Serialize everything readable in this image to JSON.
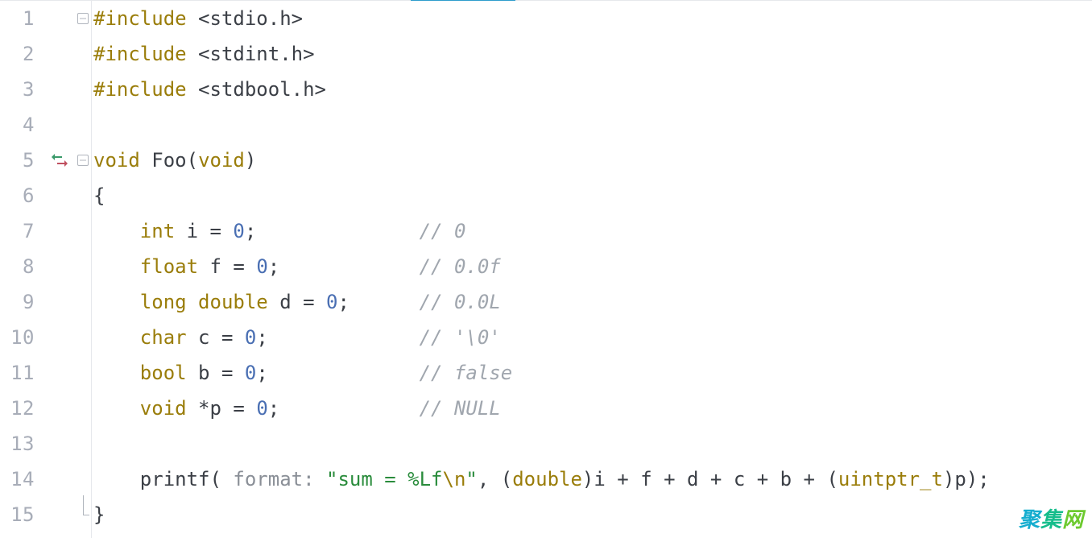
{
  "tab_accent_color": "#2e9ccc",
  "line_numbers": [
    "1",
    "2",
    "3",
    "4",
    "5",
    "6",
    "7",
    "8",
    "9",
    "10",
    "11",
    "12",
    "13",
    "14",
    "15"
  ],
  "code": {
    "lines": [
      {
        "tokens": [
          {
            "cls": "kw",
            "t": "#include"
          },
          {
            "cls": "",
            "t": " "
          },
          {
            "cls": "punct",
            "t": "<"
          },
          {
            "cls": "ident",
            "t": "stdio.h"
          },
          {
            "cls": "punct",
            "t": ">"
          }
        ]
      },
      {
        "tokens": [
          {
            "cls": "kw",
            "t": "#include"
          },
          {
            "cls": "",
            "t": " "
          },
          {
            "cls": "punct",
            "t": "<"
          },
          {
            "cls": "ident",
            "t": "stdint.h"
          },
          {
            "cls": "punct",
            "t": ">"
          }
        ]
      },
      {
        "tokens": [
          {
            "cls": "kw",
            "t": "#include"
          },
          {
            "cls": "",
            "t": " "
          },
          {
            "cls": "punct",
            "t": "<"
          },
          {
            "cls": "ident",
            "t": "stdbool.h"
          },
          {
            "cls": "punct",
            "t": ">"
          }
        ]
      },
      {
        "tokens": [
          {
            "cls": "",
            "t": ""
          }
        ]
      },
      {
        "tokens": [
          {
            "cls": "kw",
            "t": "void"
          },
          {
            "cls": "",
            "t": " "
          },
          {
            "cls": "ident",
            "t": "Foo"
          },
          {
            "cls": "punct",
            "t": "("
          },
          {
            "cls": "kw",
            "t": "void"
          },
          {
            "cls": "punct",
            "t": ")"
          }
        ]
      },
      {
        "tokens": [
          {
            "cls": "punct",
            "t": "{"
          }
        ]
      },
      {
        "tokens": [
          {
            "cls": "",
            "t": "    "
          },
          {
            "cls": "kw",
            "t": "int"
          },
          {
            "cls": "",
            "t": " "
          },
          {
            "cls": "ident",
            "t": "i"
          },
          {
            "cls": "",
            "t": " "
          },
          {
            "cls": "punct",
            "t": "="
          },
          {
            "cls": "",
            "t": " "
          },
          {
            "cls": "num",
            "t": "0"
          },
          {
            "cls": "punct",
            "t": ";"
          },
          {
            "cls": "",
            "t": "              "
          },
          {
            "cls": "cmt",
            "t": "// 0"
          }
        ]
      },
      {
        "tokens": [
          {
            "cls": "",
            "t": "    "
          },
          {
            "cls": "kw",
            "t": "float"
          },
          {
            "cls": "",
            "t": " "
          },
          {
            "cls": "ident",
            "t": "f"
          },
          {
            "cls": "",
            "t": " "
          },
          {
            "cls": "punct",
            "t": "="
          },
          {
            "cls": "",
            "t": " "
          },
          {
            "cls": "num",
            "t": "0"
          },
          {
            "cls": "punct",
            "t": ";"
          },
          {
            "cls": "",
            "t": "            "
          },
          {
            "cls": "cmt",
            "t": "// 0.0f"
          }
        ]
      },
      {
        "tokens": [
          {
            "cls": "",
            "t": "    "
          },
          {
            "cls": "kw",
            "t": "long"
          },
          {
            "cls": "",
            "t": " "
          },
          {
            "cls": "kw",
            "t": "double"
          },
          {
            "cls": "",
            "t": " "
          },
          {
            "cls": "ident",
            "t": "d"
          },
          {
            "cls": "",
            "t": " "
          },
          {
            "cls": "punct",
            "t": "="
          },
          {
            "cls": "",
            "t": " "
          },
          {
            "cls": "num",
            "t": "0"
          },
          {
            "cls": "punct",
            "t": ";"
          },
          {
            "cls": "",
            "t": "      "
          },
          {
            "cls": "cmt",
            "t": "// 0.0L"
          }
        ]
      },
      {
        "tokens": [
          {
            "cls": "",
            "t": "    "
          },
          {
            "cls": "kw",
            "t": "char"
          },
          {
            "cls": "",
            "t": " "
          },
          {
            "cls": "ident",
            "t": "c"
          },
          {
            "cls": "",
            "t": " "
          },
          {
            "cls": "punct",
            "t": "="
          },
          {
            "cls": "",
            "t": " "
          },
          {
            "cls": "num",
            "t": "0"
          },
          {
            "cls": "punct",
            "t": ";"
          },
          {
            "cls": "",
            "t": "             "
          },
          {
            "cls": "cmt",
            "t": "// '\\0'"
          }
        ]
      },
      {
        "tokens": [
          {
            "cls": "",
            "t": "    "
          },
          {
            "cls": "kw",
            "t": "bool"
          },
          {
            "cls": "",
            "t": " "
          },
          {
            "cls": "ident",
            "t": "b"
          },
          {
            "cls": "",
            "t": " "
          },
          {
            "cls": "punct",
            "t": "="
          },
          {
            "cls": "",
            "t": " "
          },
          {
            "cls": "num",
            "t": "0"
          },
          {
            "cls": "punct",
            "t": ";"
          },
          {
            "cls": "",
            "t": "             "
          },
          {
            "cls": "cmt",
            "t": "// false"
          }
        ]
      },
      {
        "tokens": [
          {
            "cls": "",
            "t": "    "
          },
          {
            "cls": "kw",
            "t": "void"
          },
          {
            "cls": "",
            "t": " "
          },
          {
            "cls": "punct",
            "t": "*"
          },
          {
            "cls": "ident",
            "t": "p"
          },
          {
            "cls": "",
            "t": " "
          },
          {
            "cls": "punct",
            "t": "="
          },
          {
            "cls": "",
            "t": " "
          },
          {
            "cls": "num",
            "t": "0"
          },
          {
            "cls": "punct",
            "t": ";"
          },
          {
            "cls": "",
            "t": "            "
          },
          {
            "cls": "cmt",
            "t": "// NULL"
          }
        ]
      },
      {
        "tokens": [
          {
            "cls": "",
            "t": ""
          }
        ]
      },
      {
        "tokens": [
          {
            "cls": "",
            "t": "    "
          },
          {
            "cls": "ident",
            "t": "printf"
          },
          {
            "cls": "punct",
            "t": "( "
          },
          {
            "cls": "hint",
            "t": "format: "
          },
          {
            "cls": "str",
            "t": "\"sum = %Lf"
          },
          {
            "cls": "escape",
            "t": "\\n"
          },
          {
            "cls": "str",
            "t": "\""
          },
          {
            "cls": "punct",
            "t": ", ("
          },
          {
            "cls": "kw",
            "t": "double"
          },
          {
            "cls": "punct",
            "t": ")"
          },
          {
            "cls": "ident",
            "t": "i"
          },
          {
            "cls": "",
            "t": " "
          },
          {
            "cls": "punct",
            "t": "+"
          },
          {
            "cls": "",
            "t": " "
          },
          {
            "cls": "ident",
            "t": "f"
          },
          {
            "cls": "",
            "t": " "
          },
          {
            "cls": "punct",
            "t": "+"
          },
          {
            "cls": "",
            "t": " "
          },
          {
            "cls": "ident",
            "t": "d"
          },
          {
            "cls": "",
            "t": " "
          },
          {
            "cls": "punct",
            "t": "+"
          },
          {
            "cls": "",
            "t": " "
          },
          {
            "cls": "ident",
            "t": "c"
          },
          {
            "cls": "",
            "t": " "
          },
          {
            "cls": "punct",
            "t": "+"
          },
          {
            "cls": "",
            "t": " "
          },
          {
            "cls": "ident",
            "t": "b"
          },
          {
            "cls": "",
            "t": " "
          },
          {
            "cls": "punct",
            "t": "+"
          },
          {
            "cls": "",
            "t": " "
          },
          {
            "cls": "punct",
            "t": "("
          },
          {
            "cls": "kw",
            "t": "uintptr_t"
          },
          {
            "cls": "punct",
            "t": ")"
          },
          {
            "cls": "ident",
            "t": "p"
          },
          {
            "cls": "punct",
            "t": ");"
          }
        ]
      },
      {
        "tokens": [
          {
            "cls": "punct",
            "t": "}"
          }
        ]
      }
    ]
  },
  "fold": {
    "1": "minus",
    "5": "minus",
    "15": "end"
  },
  "markers": {
    "5": "swap"
  },
  "watermark": "聚集网"
}
